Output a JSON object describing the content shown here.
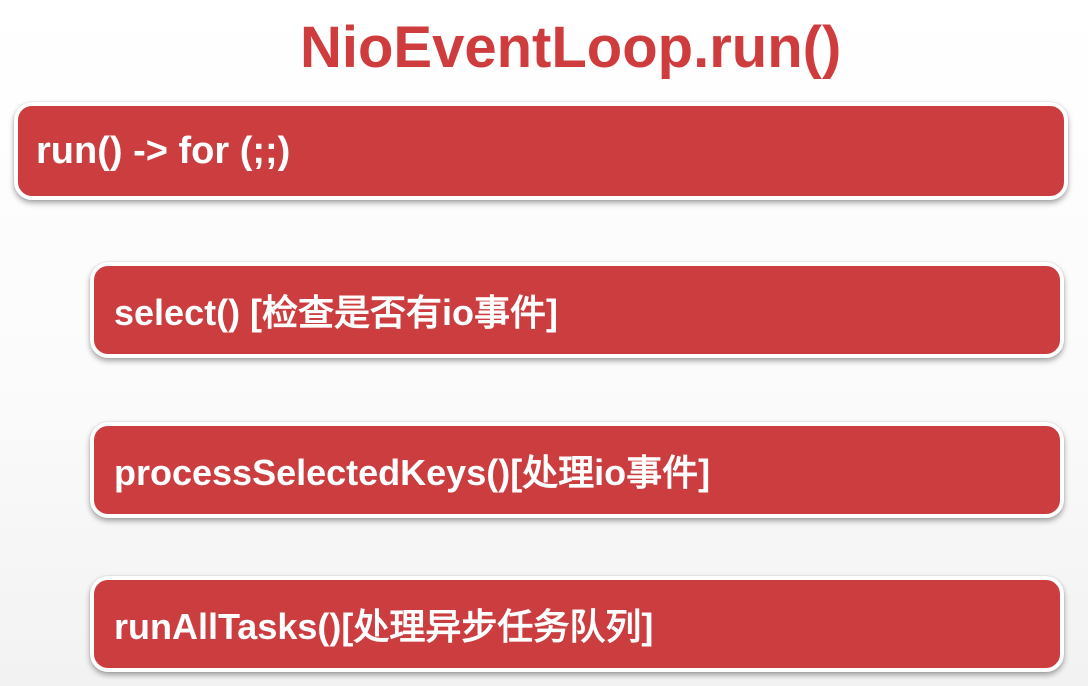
{
  "title": "NioEventLoop.run()",
  "steps": {
    "loop": "run() -> for (;;)",
    "select": "select() [检查是否有io事件]",
    "process": "processSelectedKeys()[处理io事件]",
    "tasks": "runAllTasks()[处理异步任务队列]"
  },
  "colors": {
    "title": "#cf3c3d",
    "box_fill": "#cb3d3f",
    "box_border": "#ffffff",
    "box_text": "#ffffff"
  }
}
